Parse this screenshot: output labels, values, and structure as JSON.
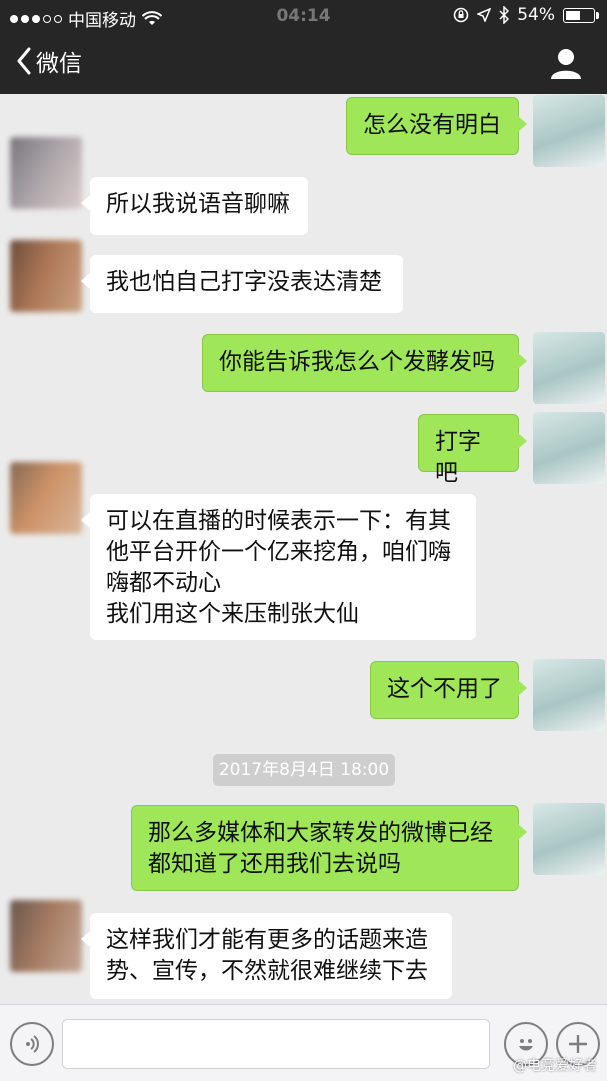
{
  "status_bar": {
    "carrier": "中国移动",
    "time": "04:14",
    "battery": "54%"
  },
  "nav": {
    "back_label": "微信"
  },
  "timestamp": "2017年8月4日 18:00",
  "messages": [
    {
      "side": "out",
      "text": "怎么没有明白"
    },
    {
      "side": "in",
      "text": "所以我说语音聊嘛"
    },
    {
      "side": "in",
      "text": "我也怕自己打字没表达清楚"
    },
    {
      "side": "out",
      "text": "你能告诉我怎么个发酵发吗"
    },
    {
      "side": "out",
      "text": "打字吧"
    },
    {
      "side": "in",
      "text": "可以在直播的时候表示一下：有其\n他平台开价一个亿来挖角，咱们嗨\n嗨都不动心\n我们用这个来压制张大仙"
    },
    {
      "side": "out",
      "text": "这个不用了"
    },
    {
      "side": "out",
      "text": "那么多媒体和大家转发的微博已经\n都知道了还用我们去说吗"
    },
    {
      "side": "in",
      "text": "这样我们才能有更多的话题来造\n势、宣传，不然就很难继续下去"
    }
  ],
  "input": {
    "placeholder": ""
  },
  "watermark": "@电竞爱好者",
  "colors": {
    "nav_bg": "#262626",
    "chat_bg": "#ebebeb",
    "outgoing_bubble": "#9fe658",
    "incoming_bubble": "#ffffff"
  },
  "icons": [
    "signal-dots-icon",
    "wifi-icon",
    "lock-rotation-icon",
    "location-icon",
    "bluetooth-icon",
    "battery-icon",
    "back-chevron-icon",
    "profile-icon",
    "voice-icon",
    "emoji-icon",
    "plus-icon"
  ]
}
